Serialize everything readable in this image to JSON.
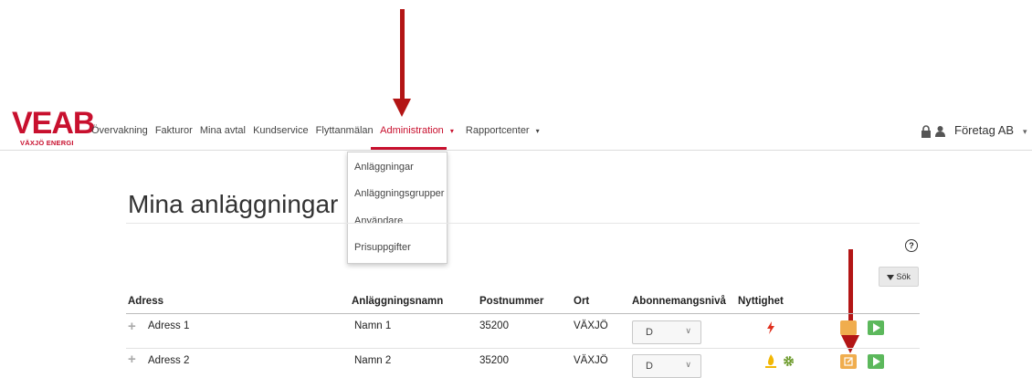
{
  "logo": {
    "main": "VEAB",
    "sub": "VÄXJÖ ENERGI"
  },
  "nav": {
    "items": [
      "Övervakning",
      "Fakturor",
      "Mina avtal",
      "Kundservice",
      "Flyttanmälan"
    ],
    "active": "Administration",
    "rapport": "Rapportcenter",
    "account": "Företag AB",
    "caret": "▾"
  },
  "dropdown": {
    "items": [
      "Anläggningar",
      "Anläggningsgrupper",
      "Användare",
      "Prisuppgifter"
    ]
  },
  "page": {
    "title": "Mina anläggningar",
    "help": "?",
    "search_label": "Sök"
  },
  "table": {
    "headers": [
      "Adress",
      "Anläggningsnamn",
      "Postnummer",
      "Ort",
      "Abonnemangsnivå",
      "Nyttighet"
    ],
    "rows": [
      {
        "adress": "Adress 1",
        "namn": "Namn 1",
        "postnummer": "35200",
        "ort": "VÄXJÖ",
        "niva": "D"
      },
      {
        "adress": "Adress 2",
        "namn": "Namn 2",
        "postnummer": "35200",
        "ort": "VÄXJÖ",
        "niva": "D"
      }
    ]
  },
  "colors": {
    "brand": "#c8102e",
    "arrow": "#b31515",
    "edit": "#f0ad4e",
    "start": "#5cb85c"
  }
}
